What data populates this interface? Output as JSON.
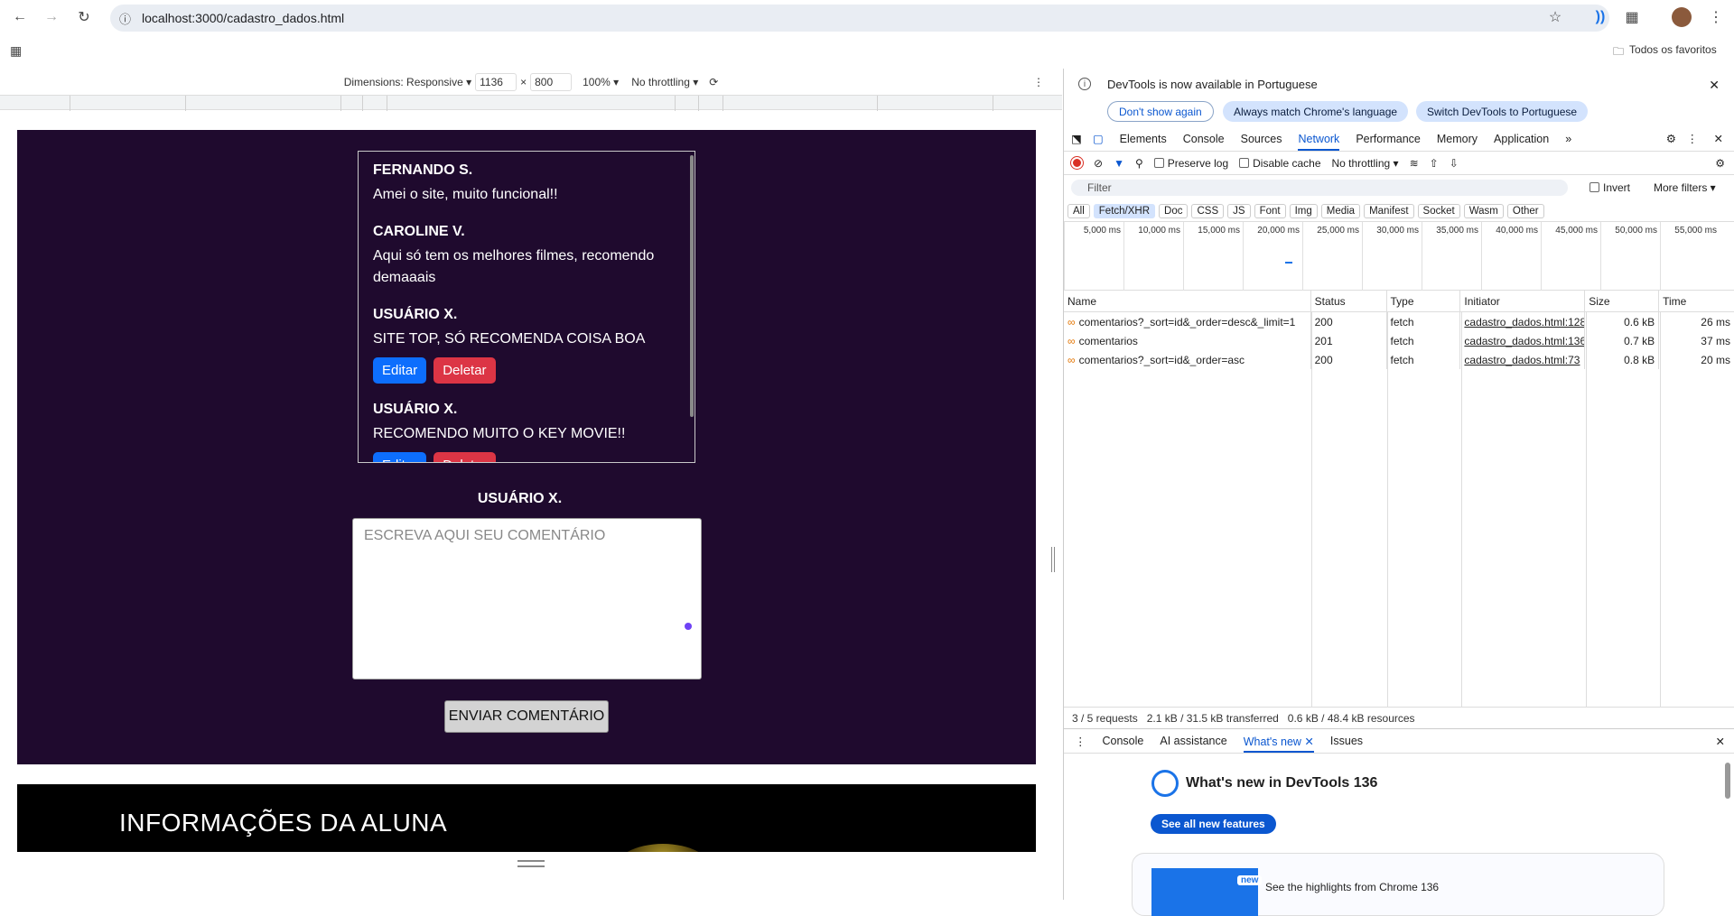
{
  "browser": {
    "url": "localhost:3000/cadastro_dados.html",
    "bookmarks_folder": "Todos os favoritos"
  },
  "device_toolbar": {
    "dimensions_label": "Dimensions: Responsive",
    "width": "1136",
    "height": "800",
    "zoom": "100%",
    "throttling": "No throttling"
  },
  "page": {
    "comments": [
      {
        "name": "FERNANDO S.",
        "text": "Amei o site, muito funcional!!"
      },
      {
        "name": "CAROLINE V.",
        "text": "Aqui só tem os melhores filmes, recomendo demaaais"
      },
      {
        "name": "USUÁRIO X.",
        "text": "SITE TOP, SÓ RECOMENDA COISA BOA"
      },
      {
        "name": "USUÁRIO X.",
        "text": "RECOMENDO MUITO O KEY MOVIE!!"
      }
    ],
    "edit_label": "Editar",
    "delete_label": "Deletar",
    "current_user": "USUÁRIO X.",
    "comment_placeholder": "ESCREVA AQUI SEU COMENTÁRIO",
    "send_label": "ENVIAR COMENTÁRIO",
    "section_heading": "INFORMAÇÕES DA ALUNA",
    "colors": {
      "bg": "#1f0a2e",
      "edit": "#0d6efd",
      "delete": "#dc3545"
    }
  },
  "devtools": {
    "banner_message": "DevTools is now available in Portuguese",
    "banner_buttons": [
      "Don't show again",
      "Always match Chrome's language",
      "Switch DevTools to Portuguese"
    ],
    "tabs": [
      "Elements",
      "Console",
      "Sources",
      "Network",
      "Performance",
      "Memory",
      "Application"
    ],
    "active_tab": "Network",
    "preserve_log": "Preserve log",
    "disable_cache": "Disable cache",
    "throttling": "No throttling",
    "filter_placeholder": "Filter",
    "invert": "Invert",
    "more_filters": "More filters",
    "type_filters": [
      "All",
      "Fetch/XHR",
      "Doc",
      "CSS",
      "JS",
      "Font",
      "Img",
      "Media",
      "Manifest",
      "Socket",
      "Wasm",
      "Other"
    ],
    "timeline_ticks": [
      "5,000 ms",
      "10,000 ms",
      "15,000 ms",
      "20,000 ms",
      "25,000 ms",
      "30,000 ms",
      "35,000 ms",
      "40,000 ms",
      "45,000 ms",
      "50,000 ms",
      "55,000 ms"
    ],
    "columns": [
      "Name",
      "Status",
      "Type",
      "Initiator",
      "Size",
      "Time"
    ],
    "requests": [
      {
        "name": "comentarios?_sort=id&_order=desc&_limit=1",
        "status": "200",
        "type": "fetch",
        "initiator": "cadastro_dados.html:128",
        "size": "0.6 kB",
        "time": "26 ms"
      },
      {
        "name": "comentarios",
        "status": "201",
        "type": "fetch",
        "initiator": "cadastro_dados.html:136",
        "size": "0.7 kB",
        "time": "37 ms"
      },
      {
        "name": "comentarios?_sort=id&_order=asc",
        "status": "200",
        "type": "fetch",
        "initiator": "cadastro_dados.html:73",
        "size": "0.8 kB",
        "time": "20 ms"
      }
    ],
    "summary": [
      "3 / 5 requests",
      "2.1 kB / 31.5 kB transferred",
      "0.6 kB / 48.4 kB resources"
    ],
    "drawer_tabs": [
      "Console",
      "AI assistance",
      "What's new",
      "Issues"
    ],
    "whats_new_title": "What's new in DevTools 136",
    "see_all": "See all new features",
    "new_badge": "new",
    "highlights": "See the highlights from Chrome 136"
  }
}
